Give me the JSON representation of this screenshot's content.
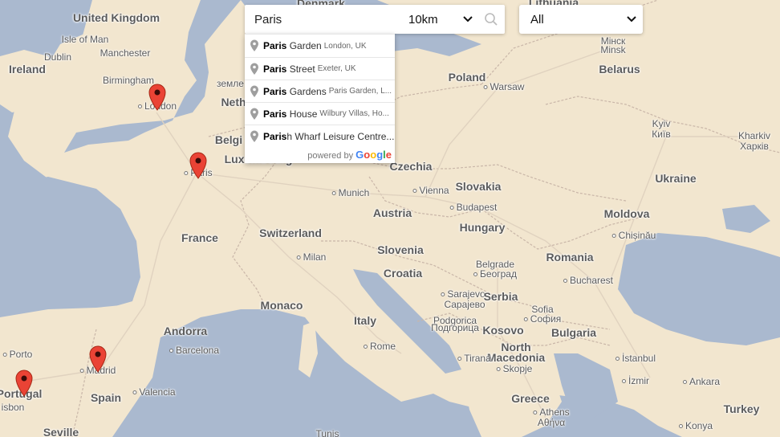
{
  "search": {
    "query": "Paris",
    "radius": "10km",
    "category": "All"
  },
  "autocomplete": {
    "items": [
      {
        "match": "Paris",
        "rest": " Garden",
        "secondary": "London, UK"
      },
      {
        "match": "Paris",
        "rest": " Street",
        "secondary": "Exeter, UK"
      },
      {
        "match": "Paris",
        "rest": " Gardens",
        "secondary": "Paris Garden, L..."
      },
      {
        "match": "Paris",
        "rest": " House",
        "secondary": "Wilbury Villas, Ho..."
      },
      {
        "match": "Paris",
        "rest": "h Wharf Leisure Centre...",
        "secondary": ""
      }
    ],
    "powered_by": "powered by",
    "google": [
      "G",
      "o",
      "o",
      "g",
      "l",
      "e"
    ],
    "google_colors": [
      "#4285f4",
      "#ea4335",
      "#fbbc05",
      "#4285f4",
      "#34a853",
      "#ea4335"
    ]
  },
  "map": {
    "labels": {
      "united_kingdom": "United Kingdom",
      "isle_of_man": "Isle of Man",
      "dublin": "Dublin",
      "ireland": "Ireland",
      "manchester": "Manchester",
      "birmingham": "Birmingham",
      "london": "London",
      "denmark": "Denmark",
      "lithuania": "Lithuania",
      "minsk_cyr": "Мінск",
      "minsk": "Minsk",
      "belarus": "Belarus",
      "poland": "Poland",
      "warsaw": "Warsaw",
      "netherlands_cut": "Neth",
      "netherlands_cyr": "земле",
      "belgium": "Belgi",
      "luxembourg": "Luxembourg",
      "paris": "Paris",
      "czechia": "Czechia",
      "kyiv": "Kyiv",
      "kyiv_cyr": "Київ",
      "kharkiv": "Kharkiv",
      "kharkiv_cyr": "Харків",
      "ukraine": "Ukraine",
      "slovakia": "Slovakia",
      "munich": "Munich",
      "vienna": "Vienna",
      "austria": "Austria",
      "budapest": "Budapest",
      "moldova": "Moldova",
      "chisinau": "Chișinău",
      "france": "France",
      "switzerland": "Switzerland",
      "hungary": "Hungary",
      "milan": "Milan",
      "slovenia": "Slovenia",
      "belgrade": "Belgrade",
      "belgrade_cyr": "Београд",
      "romania": "Romania",
      "croatia": "Croatia",
      "bucharest": "Bucharest",
      "sarajevo": "Sarajevo",
      "sarajevo_cyr": "Сарајево",
      "serbia": "Serbia",
      "monaco": "Monaco",
      "italy": "Italy",
      "sofia": "Sofia",
      "sofia_cyr": "София",
      "podgorica": "Podgorica",
      "podgorica_cyr": "Подгорица",
      "kosovo": "Kosovo",
      "bulgaria": "Bulgaria",
      "andorra": "Andorra",
      "barcelona": "Barcelona",
      "rome": "Rome",
      "north_macedonia_1": "North",
      "north_macedonia_2": "Macedonia",
      "tirana": "Tirana",
      "skopje": "Skopje",
      "istanbul": "İstanbul",
      "porto": "Porto",
      "madrid": "Madrid",
      "izmir": "İzmir",
      "ankara": "Ankara",
      "portugal": "Portugal",
      "spain": "Spain",
      "valencia": "Valencia",
      "greece": "Greece",
      "athens": "Athens",
      "athens_cyr": "Αθήνα",
      "konya": "Konya",
      "turkey": "Turkey",
      "lisbon": "isbon",
      "seville": "Seville",
      "tunis": "Tunis"
    },
    "marker_color": "#ea4335"
  }
}
